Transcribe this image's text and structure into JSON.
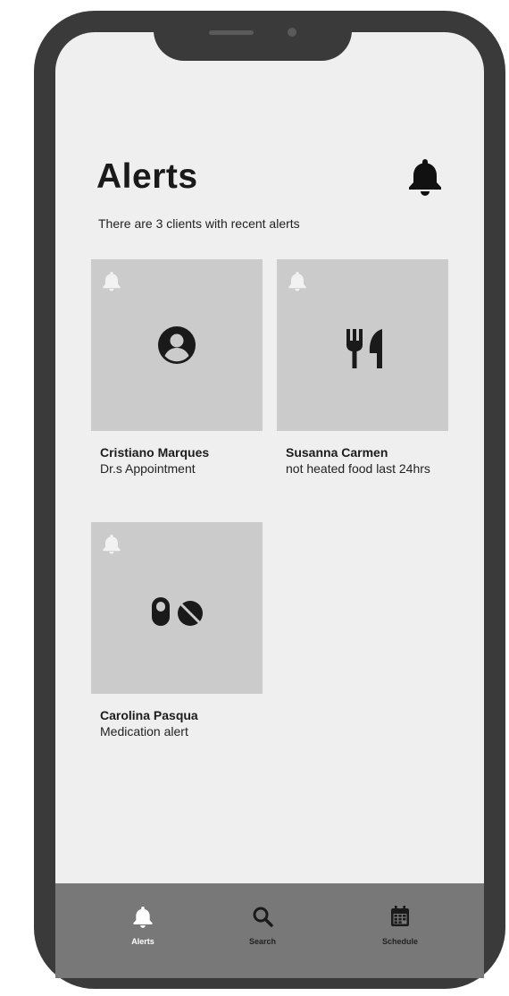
{
  "header": {
    "title": "Alerts",
    "subtitle": "There are 3 clients with recent alerts",
    "bell_icon": "bell-icon"
  },
  "alerts": [
    {
      "name": "Cristiano Marques",
      "detail": "Dr.s Appointment",
      "icon": "user-circle-icon"
    },
    {
      "name": "Susanna Carmen",
      "detail": "not heated food last 24hrs",
      "icon": "utensils-icon"
    },
    {
      "name": "Carolina Pasqua",
      "detail": "Medication alert",
      "icon": "pills-icon"
    }
  ],
  "tabs": [
    {
      "label": "Alerts",
      "icon": "bell-icon",
      "active": true
    },
    {
      "label": "Search",
      "icon": "search-icon",
      "active": false
    },
    {
      "label": "Schedule",
      "icon": "calendar-icon",
      "active": false
    }
  ],
  "colors": {
    "frame": "#3a3a3a",
    "screen": "#efefef",
    "card": "#cbcbcb",
    "tabbar": "#787878",
    "active_tab": "#ffffff"
  }
}
